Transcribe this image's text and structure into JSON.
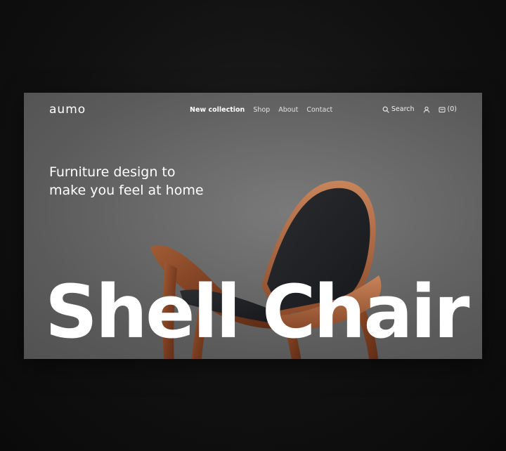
{
  "brand": {
    "logo": "aumo"
  },
  "nav": {
    "items": [
      {
        "label": "New collection",
        "active": true
      },
      {
        "label": "Shop",
        "active": false
      },
      {
        "label": "About",
        "active": false
      },
      {
        "label": "Contact",
        "active": false
      }
    ]
  },
  "actions": {
    "search_label": "Search",
    "search_icon": "search-icon",
    "account_icon": "user-icon",
    "cart_icon": "cart-icon",
    "cart_count": "(0)"
  },
  "hero": {
    "tagline_line1": "Furniture design to",
    "tagline_line2": "make you feel at home",
    "title": "Shell Chair"
  },
  "colors": {
    "page_background": "#0c0c0c",
    "hero_background": "#6a6a6a",
    "text": "#ffffff",
    "wood": "#8a4a2a",
    "cushion": "#1e1f22"
  }
}
